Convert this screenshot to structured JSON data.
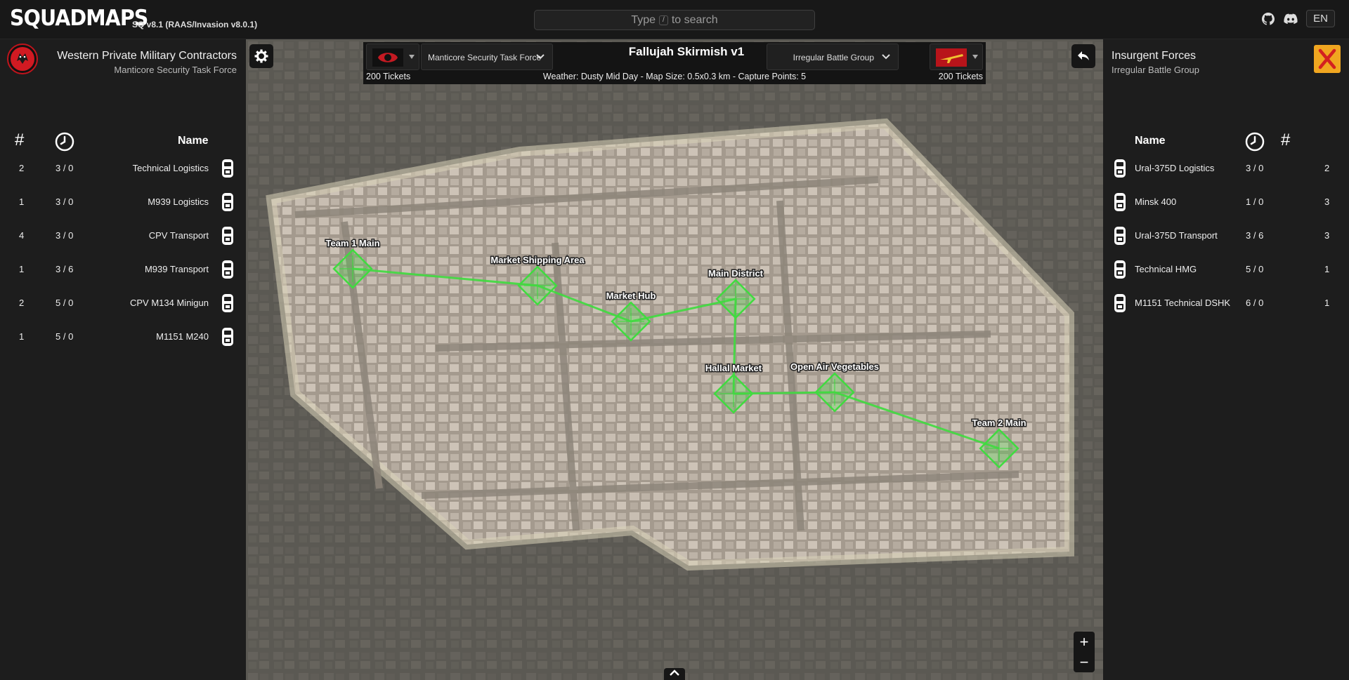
{
  "app": {
    "logo": "SQUADMAPS",
    "version": "SQ v8.1 (RAAS/Invasion v8.0.1)"
  },
  "search": {
    "pre": "Type",
    "key": "/",
    "post": "to search"
  },
  "topbar": {
    "icons": [
      "github-icon",
      "discord-icon"
    ],
    "language": "EN"
  },
  "team1": {
    "faction": "Western Private Military Contractors",
    "unit": "Manticore Security Task Force",
    "logo_text": "Manticore",
    "tickets": "200 Tickets",
    "headers": {
      "count": "#",
      "time": "clock-icon",
      "name": "Name"
    },
    "vehicles": [
      {
        "count": "2",
        "time": "3 / 0",
        "name": "Technical Logistics",
        "icon": "logistics-vehicle-icon"
      },
      {
        "count": "1",
        "time": "3 / 0",
        "name": "M939 Logistics",
        "icon": "logistics-truck-icon"
      },
      {
        "count": "4",
        "time": "3 / 0",
        "name": "CPV Transport",
        "icon": "transport-car-icon"
      },
      {
        "count": "1",
        "time": "3 / 6",
        "name": "M939 Transport",
        "icon": "transport-truck-icon"
      },
      {
        "count": "2",
        "time": "5 / 0",
        "name": "CPV M134 Minigun",
        "icon": "armed-car-icon"
      },
      {
        "count": "1",
        "time": "5 / 0",
        "name": "M1151 M240",
        "icon": "armed-car-icon"
      }
    ]
  },
  "team2": {
    "faction": "Insurgent Forces",
    "unit": "Irregular Battle Group",
    "tickets": "200 Tickets",
    "headers": {
      "count": "#",
      "time": "clock-icon",
      "name": "Name"
    },
    "vehicles": [
      {
        "count": "2",
        "time": "3 / 0",
        "name": "Ural-375D Logistics",
        "icon": "logistics-truck-icon"
      },
      {
        "count": "3",
        "time": "1 / 0",
        "name": "Minsk 400",
        "icon": "motorbike-icon"
      },
      {
        "count": "3",
        "time": "3 / 6",
        "name": "Ural-375D Transport",
        "icon": "transport-truck-icon"
      },
      {
        "count": "1",
        "time": "5 / 0",
        "name": "Technical HMG",
        "icon": "armed-car-icon"
      },
      {
        "count": "1",
        "time": "6 / 0",
        "name": "M1151 Technical DSHK",
        "icon": "armed-car-icon"
      }
    ]
  },
  "layer": {
    "name": "Fallujah Skirmish v1",
    "info": "Weather: Dusty Mid Day - Map Size: 0.5x0.3 km - Capture Points: 5",
    "team1_select": "Manticore Security Task Force",
    "team2_select": "Irregular Battle Group"
  },
  "capture_points": [
    {
      "name": "Team 1 Main"
    },
    {
      "name": "Market Shipping Area"
    },
    {
      "name": "Market Hub"
    },
    {
      "name": "Main District"
    },
    {
      "name": "Hallal Market"
    },
    {
      "name": "Open Air Vegetables"
    },
    {
      "name": "Team 2 Main"
    }
  ],
  "zoom": {
    "in": "+",
    "out": "−"
  },
  "colors": {
    "lane": "#3fdc3f",
    "panel": "#1d1d1d",
    "topbar": "#181818"
  }
}
